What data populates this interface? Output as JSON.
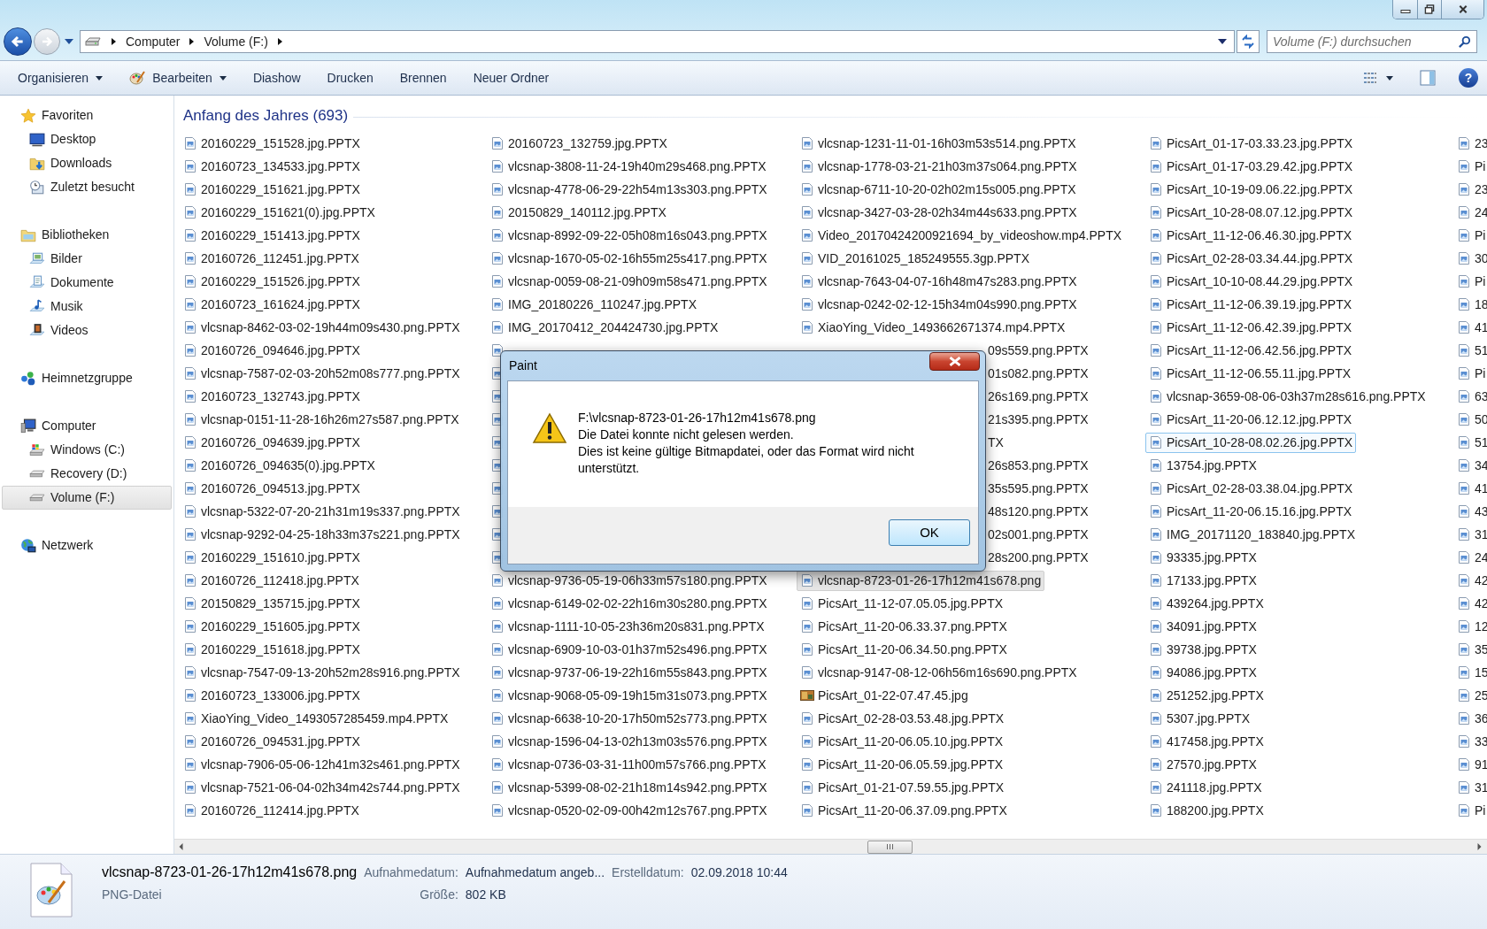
{
  "address": {
    "breadcrumbs": [
      "Computer",
      "Volume (F:)"
    ]
  },
  "search": {
    "placeholder": "Volume (F:) durchsuchen"
  },
  "toolbar": [
    {
      "label": "Organisieren",
      "kind": "dropdown"
    },
    {
      "label": "Bearbeiten",
      "kind": "icon-dropdown"
    },
    {
      "label": "Diashow",
      "kind": "plain"
    },
    {
      "label": "Drucken",
      "kind": "plain"
    },
    {
      "label": "Brennen",
      "kind": "plain"
    },
    {
      "label": "Neuer Ordner",
      "kind": "plain"
    }
  ],
  "help_glyph": "?",
  "sidebar": [
    {
      "label": "Favoriten",
      "kind": "favorites",
      "selected": false,
      "children": [
        {
          "label": "Desktop",
          "kind": "desktop",
          "selected": false
        },
        {
          "label": "Downloads",
          "kind": "downloads",
          "selected": false
        },
        {
          "label": "Zuletzt besucht",
          "kind": "recent",
          "selected": false
        }
      ]
    },
    {
      "label": "Bibliotheken",
      "kind": "libraries",
      "selected": false,
      "children": [
        {
          "label": "Bilder",
          "kind": "pictures",
          "selected": false
        },
        {
          "label": "Dokumente",
          "kind": "documents",
          "selected": false
        },
        {
          "label": "Musik",
          "kind": "music",
          "selected": false
        },
        {
          "label": "Videos",
          "kind": "videos",
          "selected": false
        }
      ]
    },
    {
      "label": "Heimnetzgruppe",
      "kind": "homegroup",
      "selected": false
    },
    {
      "label": "Computer",
      "kind": "computer",
      "selected": false,
      "children": [
        {
          "label": "Windows (C:)",
          "kind": "system-drive",
          "selected": false
        },
        {
          "label": "Recovery (D:)",
          "kind": "drive",
          "selected": false
        },
        {
          "label": "Volume (F:)",
          "kind": "drive",
          "selected": true
        }
      ]
    },
    {
      "label": "Netzwerk",
      "kind": "network",
      "selected": false
    }
  ],
  "group_header": "Anfang des Jahres (693)",
  "columns": [
    {
      "items": [
        {
          "name": "20160229_151528.jpg.PPTX",
          "kind": "file",
          "selected": false,
          "focused": false
        },
        {
          "name": "20160723_134533.jpg.PPTX",
          "kind": "file",
          "selected": false,
          "focused": false
        },
        {
          "name": "20160229_151621.jpg.PPTX",
          "kind": "file",
          "selected": false,
          "focused": false
        },
        {
          "name": "20160229_151621(0).jpg.PPTX",
          "kind": "file",
          "selected": false,
          "focused": false
        },
        {
          "name": "20160229_151413.jpg.PPTX",
          "kind": "file",
          "selected": false,
          "focused": false
        },
        {
          "name": "20160726_112451.jpg.PPTX",
          "kind": "file",
          "selected": false,
          "focused": false
        },
        {
          "name": "20160229_151526.jpg.PPTX",
          "kind": "file",
          "selected": false,
          "focused": false
        },
        {
          "name": "20160723_161624.jpg.PPTX",
          "kind": "file",
          "selected": false,
          "focused": false
        },
        {
          "name": "vlcsnap-8462-03-02-19h44m09s430.png.PPTX",
          "kind": "file",
          "selected": false,
          "focused": false
        },
        {
          "name": "20160726_094646.jpg.PPTX",
          "kind": "file",
          "selected": false,
          "focused": false
        },
        {
          "name": "vlcsnap-7587-02-03-20h52m08s777.png.PPTX",
          "kind": "file",
          "selected": false,
          "focused": false
        },
        {
          "name": "20160723_132743.jpg.PPTX",
          "kind": "file",
          "selected": false,
          "focused": false
        },
        {
          "name": "vlcsnap-0151-11-28-16h26m27s587.png.PPTX",
          "kind": "file",
          "selected": false,
          "focused": false
        },
        {
          "name": "20160726_094639.jpg.PPTX",
          "kind": "file",
          "selected": false,
          "focused": false
        },
        {
          "name": "20160726_094635(0).jpg.PPTX",
          "kind": "file",
          "selected": false,
          "focused": false
        },
        {
          "name": "20160726_094513.jpg.PPTX",
          "kind": "file",
          "selected": false,
          "focused": false
        },
        {
          "name": "vlcsnap-5322-07-20-21h31m19s337.png.PPTX",
          "kind": "file",
          "selected": false,
          "focused": false
        },
        {
          "name": "vlcsnap-9292-04-25-18h33m37s221.png.PPTX",
          "kind": "file",
          "selected": false,
          "focused": false
        },
        {
          "name": "20160229_151610.jpg.PPTX",
          "kind": "file",
          "selected": false,
          "focused": false
        },
        {
          "name": "20160726_112418.jpg.PPTX",
          "kind": "file",
          "selected": false,
          "focused": false
        },
        {
          "name": "20150829_135715.jpg.PPTX",
          "kind": "file",
          "selected": false,
          "focused": false
        },
        {
          "name": "20160229_151605.jpg.PPTX",
          "kind": "file",
          "selected": false,
          "focused": false
        },
        {
          "name": "20160229_151618.jpg.PPTX",
          "kind": "file",
          "selected": false,
          "focused": false
        },
        {
          "name": "vlcsnap-7547-09-13-20h52m28s916.png.PPTX",
          "kind": "file",
          "selected": false,
          "focused": false
        },
        {
          "name": "20160723_133006.jpg.PPTX",
          "kind": "file",
          "selected": false,
          "focused": false
        },
        {
          "name": "XiaoYing_Video_1493057285459.mp4.PPTX",
          "kind": "file",
          "selected": false,
          "focused": false
        },
        {
          "name": "20160726_094531.jpg.PPTX",
          "kind": "file",
          "selected": false,
          "focused": false
        },
        {
          "name": "vlcsnap-7906-05-06-12h41m32s461.png.PPTX",
          "kind": "file",
          "selected": false,
          "focused": false
        },
        {
          "name": "vlcsnap-7521-06-04-02h34m42s744.png.PPTX",
          "kind": "file",
          "selected": false,
          "focused": false
        },
        {
          "name": "20160726_112414.jpg.PPTX",
          "kind": "file",
          "selected": false,
          "focused": false
        }
      ]
    },
    {
      "items": [
        {
          "name": "20160723_132759.jpg.PPTX",
          "kind": "file",
          "selected": false,
          "focused": false
        },
        {
          "name": "vlcsnap-3808-11-24-19h40m29s468.png.PPTX",
          "kind": "file",
          "selected": false,
          "focused": false
        },
        {
          "name": "vlcsnap-4778-06-29-22h54m13s303.png.PPTX",
          "kind": "file",
          "selected": false,
          "focused": false
        },
        {
          "name": "20150829_140112.jpg.PPTX",
          "kind": "file",
          "selected": false,
          "focused": false
        },
        {
          "name": "vlcsnap-8992-09-22-05h08m16s043.png.PPTX",
          "kind": "file",
          "selected": false,
          "focused": false
        },
        {
          "name": "vlcsnap-1670-05-02-16h55m25s417.png.PPTX",
          "kind": "file",
          "selected": false,
          "focused": false
        },
        {
          "name": "vlcsnap-0059-08-21-09h09m58s471.png.PPTX",
          "kind": "file",
          "selected": false,
          "focused": false
        },
        {
          "name": "IMG_20180226_110247.jpg.PPTX",
          "kind": "file",
          "selected": false,
          "focused": false
        },
        {
          "name": "IMG_20170412_204424730.jpg.PPTX",
          "kind": "file",
          "selected": false,
          "focused": false
        },
        {
          "kind": "covered"
        },
        {
          "kind": "covered"
        },
        {
          "kind": "covered"
        },
        {
          "kind": "covered"
        },
        {
          "kind": "covered"
        },
        {
          "kind": "covered"
        },
        {
          "kind": "covered"
        },
        {
          "kind": "covered"
        },
        {
          "kind": "covered"
        },
        {
          "kind": "covered"
        },
        {
          "name": "vlcsnap-9736-05-19-06h33m57s180.png.PPTX",
          "kind": "file",
          "selected": false,
          "focused": false
        },
        {
          "name": "vlcsnap-6149-02-02-22h16m30s280.png.PPTX",
          "kind": "file",
          "selected": false,
          "focused": false
        },
        {
          "name": "vlcsnap-1111-10-05-23h36m20s831.png.PPTX",
          "kind": "file",
          "selected": false,
          "focused": false
        },
        {
          "name": "vlcsnap-6909-10-03-01h37m52s496.png.PPTX",
          "kind": "file",
          "selected": false,
          "focused": false
        },
        {
          "name": "vlcsnap-9737-06-19-22h16m55s843.png.PPTX",
          "kind": "file",
          "selected": false,
          "focused": false
        },
        {
          "name": "vlcsnap-9068-05-09-19h15m31s073.png.PPTX",
          "kind": "file",
          "selected": false,
          "focused": false
        },
        {
          "name": "vlcsnap-6638-10-20-17h50m52s773.png.PPTX",
          "kind": "file",
          "selected": false,
          "focused": false
        },
        {
          "name": "vlcsnap-1596-04-13-02h13m03s576.png.PPTX",
          "kind": "file",
          "selected": false,
          "focused": false
        },
        {
          "name": "vlcsnap-0736-03-31-11h00m57s766.png.PPTX",
          "kind": "file",
          "selected": false,
          "focused": false
        },
        {
          "name": "vlcsnap-5399-08-02-21h18m14s942.png.PPTX",
          "kind": "file",
          "selected": false,
          "focused": false
        },
        {
          "name": "vlcsnap-0520-02-09-00h42m12s767.png.PPTX",
          "kind": "file",
          "selected": false,
          "focused": false
        }
      ]
    },
    {
      "items": [
        {
          "name": "vlcsnap-1231-11-01-16h03m53s514.png.PPTX",
          "kind": "file",
          "selected": false,
          "focused": false
        },
        {
          "name": "vlcsnap-1778-03-21-21h03m37s064.png.PPTX",
          "kind": "file",
          "selected": false,
          "focused": false
        },
        {
          "name": "vlcsnap-6711-10-20-02h02m15s005.png.PPTX",
          "kind": "file",
          "selected": false,
          "focused": false
        },
        {
          "name": "vlcsnap-3427-03-28-02h34m44s633.png.PPTX",
          "kind": "file",
          "selected": false,
          "focused": false
        },
        {
          "name": "Video_20170424200921694_by_videoshow.mp4.PPTX",
          "kind": "file",
          "selected": false,
          "focused": false
        },
        {
          "name": "VID_20161025_185249555.3gp.PPTX",
          "kind": "file",
          "selected": false,
          "focused": false
        },
        {
          "name": "vlcsnap-7643-04-07-16h48m47s283.png.PPTX",
          "kind": "file",
          "selected": false,
          "focused": false
        },
        {
          "name": "vlcsnap-0242-02-12-15h34m04s990.png.PPTX",
          "kind": "file",
          "selected": false,
          "focused": false
        },
        {
          "name": "XiaoYing_Video_1493662671374.mp4.PPTX",
          "kind": "file",
          "selected": false,
          "focused": false
        },
        {
          "name": "09s559.png.PPTX",
          "kind": "partial",
          "selected": false,
          "focused": false
        },
        {
          "name": "01s082.png.PPTX",
          "kind": "partial",
          "selected": false,
          "focused": false
        },
        {
          "name": "26s169.png.PPTX",
          "kind": "partial",
          "selected": false,
          "focused": false
        },
        {
          "name": "21s395.png.PPTX",
          "kind": "partial",
          "selected": false,
          "focused": false
        },
        {
          "name": "TX",
          "kind": "partial",
          "selected": false,
          "focused": false
        },
        {
          "name": "26s853.png.PPTX",
          "kind": "partial",
          "selected": false,
          "focused": false
        },
        {
          "name": "35s595.png.PPTX",
          "kind": "partial",
          "selected": false,
          "focused": false
        },
        {
          "name": "48s120.png.PPTX",
          "kind": "partial",
          "selected": false,
          "focused": false
        },
        {
          "name": "02s001.png.PPTX",
          "kind": "partial",
          "selected": false,
          "focused": false
        },
        {
          "name": "28s200.png.PPTX",
          "kind": "partial",
          "selected": false,
          "focused": false
        },
        {
          "name": "vlcsnap-8723-01-26-17h12m41s678.png",
          "kind": "file",
          "selected": true,
          "focused": false
        },
        {
          "name": "PicsArt_11-12-07.05.05.jpg.PPTX",
          "kind": "file",
          "selected": false,
          "focused": false
        },
        {
          "name": "PicsArt_11-20-06.33.37.png.PPTX",
          "kind": "file",
          "selected": false,
          "focused": false
        },
        {
          "name": "PicsArt_11-20-06.34.50.png.PPTX",
          "kind": "file",
          "selected": false,
          "focused": false
        },
        {
          "name": "vlcsnap-9147-08-12-06h56m16s690.png.PPTX",
          "kind": "file",
          "selected": false,
          "focused": false
        },
        {
          "name": "PicsArt_01-22-07.47.45.jpg",
          "kind": "image",
          "selected": false,
          "focused": false
        },
        {
          "name": "PicsArt_02-28-03.53.48.jpg.PPTX",
          "kind": "file",
          "selected": false,
          "focused": false
        },
        {
          "name": "PicsArt_11-20-06.05.10.jpg.PPTX",
          "kind": "file",
          "selected": false,
          "focused": false
        },
        {
          "name": "PicsArt_11-20-06.05.59.jpg.PPTX",
          "kind": "file",
          "selected": false,
          "focused": false
        },
        {
          "name": "PicsArt_01-21-07.59.55.jpg.PPTX",
          "kind": "file",
          "selected": false,
          "focused": false
        },
        {
          "name": "PicsArt_11-20-06.37.09.png.PPTX",
          "kind": "file",
          "selected": false,
          "focused": false
        }
      ]
    },
    {
      "items": [
        {
          "name": "PicsArt_01-17-03.33.23.jpg.PPTX",
          "kind": "file",
          "selected": false,
          "focused": false
        },
        {
          "name": "PicsArt_01-17-03.29.42.jpg.PPTX",
          "kind": "file",
          "selected": false,
          "focused": false
        },
        {
          "name": "PicsArt_10-19-09.06.22.jpg.PPTX",
          "kind": "file",
          "selected": false,
          "focused": false
        },
        {
          "name": "PicsArt_10-28-08.07.12.jpg.PPTX",
          "kind": "file",
          "selected": false,
          "focused": false
        },
        {
          "name": "PicsArt_11-12-06.46.30.jpg.PPTX",
          "kind": "file",
          "selected": false,
          "focused": false
        },
        {
          "name": "PicsArt_02-28-03.34.44.jpg.PPTX",
          "kind": "file",
          "selected": false,
          "focused": false
        },
        {
          "name": "PicsArt_10-10-08.44.29.jpg.PPTX",
          "kind": "file",
          "selected": false,
          "focused": false
        },
        {
          "name": "PicsArt_11-12-06.39.19.jpg.PPTX",
          "kind": "file",
          "selected": false,
          "focused": false
        },
        {
          "name": "PicsArt_11-12-06.42.39.jpg.PPTX",
          "kind": "file",
          "selected": false,
          "focused": false
        },
        {
          "name": "PicsArt_11-12-06.42.56.jpg.PPTX",
          "kind": "file",
          "selected": false,
          "focused": false
        },
        {
          "name": "PicsArt_11-12-06.55.11.jpg.PPTX",
          "kind": "file",
          "selected": false,
          "focused": false
        },
        {
          "name": "vlcsnap-3659-08-06-03h37m28s616.png.PPTX",
          "kind": "file",
          "selected": false,
          "focused": false
        },
        {
          "name": "PicsArt_11-20-06.12.12.jpg.PPTX",
          "kind": "file",
          "selected": false,
          "focused": false
        },
        {
          "name": "PicsArt_10-28-08.02.26.jpg.PPTX",
          "kind": "file",
          "selected": false,
          "focused": true
        },
        {
          "name": "13754.jpg.PPTX",
          "kind": "file",
          "selected": false,
          "focused": false
        },
        {
          "name": "PicsArt_02-28-03.38.04.jpg.PPTX",
          "kind": "file",
          "selected": false,
          "focused": false
        },
        {
          "name": "PicsArt_11-20-06.15.16.jpg.PPTX",
          "kind": "file",
          "selected": false,
          "focused": false
        },
        {
          "name": "IMG_20171120_183840.jpg.PPTX",
          "kind": "file",
          "selected": false,
          "focused": false
        },
        {
          "name": "93335.jpg.PPTX",
          "kind": "file",
          "selected": false,
          "focused": false
        },
        {
          "name": "17133.jpg.PPTX",
          "kind": "file",
          "selected": false,
          "focused": false
        },
        {
          "name": "439264.jpg.PPTX",
          "kind": "file",
          "selected": false,
          "focused": false
        },
        {
          "name": "34091.jpg.PPTX",
          "kind": "file",
          "selected": false,
          "focused": false
        },
        {
          "name": "39738.jpg.PPTX",
          "kind": "file",
          "selected": false,
          "focused": false
        },
        {
          "name": "94086.jpg.PPTX",
          "kind": "file",
          "selected": false,
          "focused": false
        },
        {
          "name": "251252.jpg.PPTX",
          "kind": "file",
          "selected": false,
          "focused": false
        },
        {
          "name": "5307.jpg.PPTX",
          "kind": "file",
          "selected": false,
          "focused": false
        },
        {
          "name": "417458.jpg.PPTX",
          "kind": "file",
          "selected": false,
          "focused": false
        },
        {
          "name": "27570.jpg.PPTX",
          "kind": "file",
          "selected": false,
          "focused": false
        },
        {
          "name": "241118.jpg.PPTX",
          "kind": "file",
          "selected": false,
          "focused": false
        },
        {
          "name": "188200.jpg.PPTX",
          "kind": "file",
          "selected": false,
          "focused": false
        }
      ]
    },
    {
      "items": [
        {
          "name": "23",
          "kind": "file",
          "selected": false,
          "focused": false
        },
        {
          "name": "Pi",
          "kind": "file",
          "selected": false,
          "focused": false
        },
        {
          "name": "23",
          "kind": "file",
          "selected": false,
          "focused": false
        },
        {
          "name": "24",
          "kind": "file",
          "selected": false,
          "focused": false
        },
        {
          "name": "Pi",
          "kind": "file",
          "selected": false,
          "focused": false
        },
        {
          "name": "30",
          "kind": "file",
          "selected": false,
          "focused": false
        },
        {
          "name": "Pi",
          "kind": "file",
          "selected": false,
          "focused": false
        },
        {
          "name": "18",
          "kind": "file",
          "selected": false,
          "focused": false
        },
        {
          "name": "41",
          "kind": "file",
          "selected": false,
          "focused": false
        },
        {
          "name": "51",
          "kind": "file",
          "selected": false,
          "focused": false
        },
        {
          "name": "Pi",
          "kind": "file",
          "selected": false,
          "focused": false
        },
        {
          "name": "63",
          "kind": "file",
          "selected": false,
          "focused": false
        },
        {
          "name": "50",
          "kind": "file",
          "selected": false,
          "focused": false
        },
        {
          "name": "51",
          "kind": "file",
          "selected": false,
          "focused": false
        },
        {
          "name": "34",
          "kind": "file",
          "selected": false,
          "focused": false
        },
        {
          "name": "41",
          "kind": "file",
          "selected": false,
          "focused": false
        },
        {
          "name": "43",
          "kind": "file",
          "selected": false,
          "focused": false
        },
        {
          "name": "31",
          "kind": "file",
          "selected": false,
          "focused": false
        },
        {
          "name": "24",
          "kind": "file",
          "selected": false,
          "focused": false
        },
        {
          "name": "42",
          "kind": "file",
          "selected": false,
          "focused": false
        },
        {
          "name": "42",
          "kind": "file",
          "selected": false,
          "focused": false
        },
        {
          "name": "12",
          "kind": "file",
          "selected": false,
          "focused": false
        },
        {
          "name": "35",
          "kind": "file",
          "selected": false,
          "focused": false
        },
        {
          "name": "15",
          "kind": "file",
          "selected": false,
          "focused": false
        },
        {
          "name": "25",
          "kind": "file",
          "selected": false,
          "focused": false
        },
        {
          "name": "36",
          "kind": "file",
          "selected": false,
          "focused": false
        },
        {
          "name": "33",
          "kind": "file",
          "selected": false,
          "focused": false
        },
        {
          "name": "91",
          "kind": "file",
          "selected": false,
          "focused": false
        },
        {
          "name": "31",
          "kind": "file",
          "selected": false,
          "focused": false
        },
        {
          "name": "Pi",
          "kind": "file",
          "selected": false,
          "focused": false
        }
      ]
    }
  ],
  "details": {
    "file_name": "vlcsnap-8723-01-26-17h12m41s678.png",
    "file_type": "PNG-Datei",
    "fields": [
      {
        "label": "Aufnahmedatum:",
        "value": "Aufnahmedatum angeb..."
      },
      {
        "label": "Erstelldatum:",
        "value": "02.09.2018 10:44"
      },
      {
        "label": "Größe:",
        "value": "802 KB"
      }
    ]
  },
  "dialog": {
    "title": "Paint",
    "lines": [
      "F:\\vlcsnap-8723-01-26-17h12m41s678.png",
      "Die Datei konnte nicht gelesen werden.",
      "Dies ist keine gültige Bitmapdatei, oder das Format wird nicht unterstützt."
    ],
    "button": "OK"
  }
}
